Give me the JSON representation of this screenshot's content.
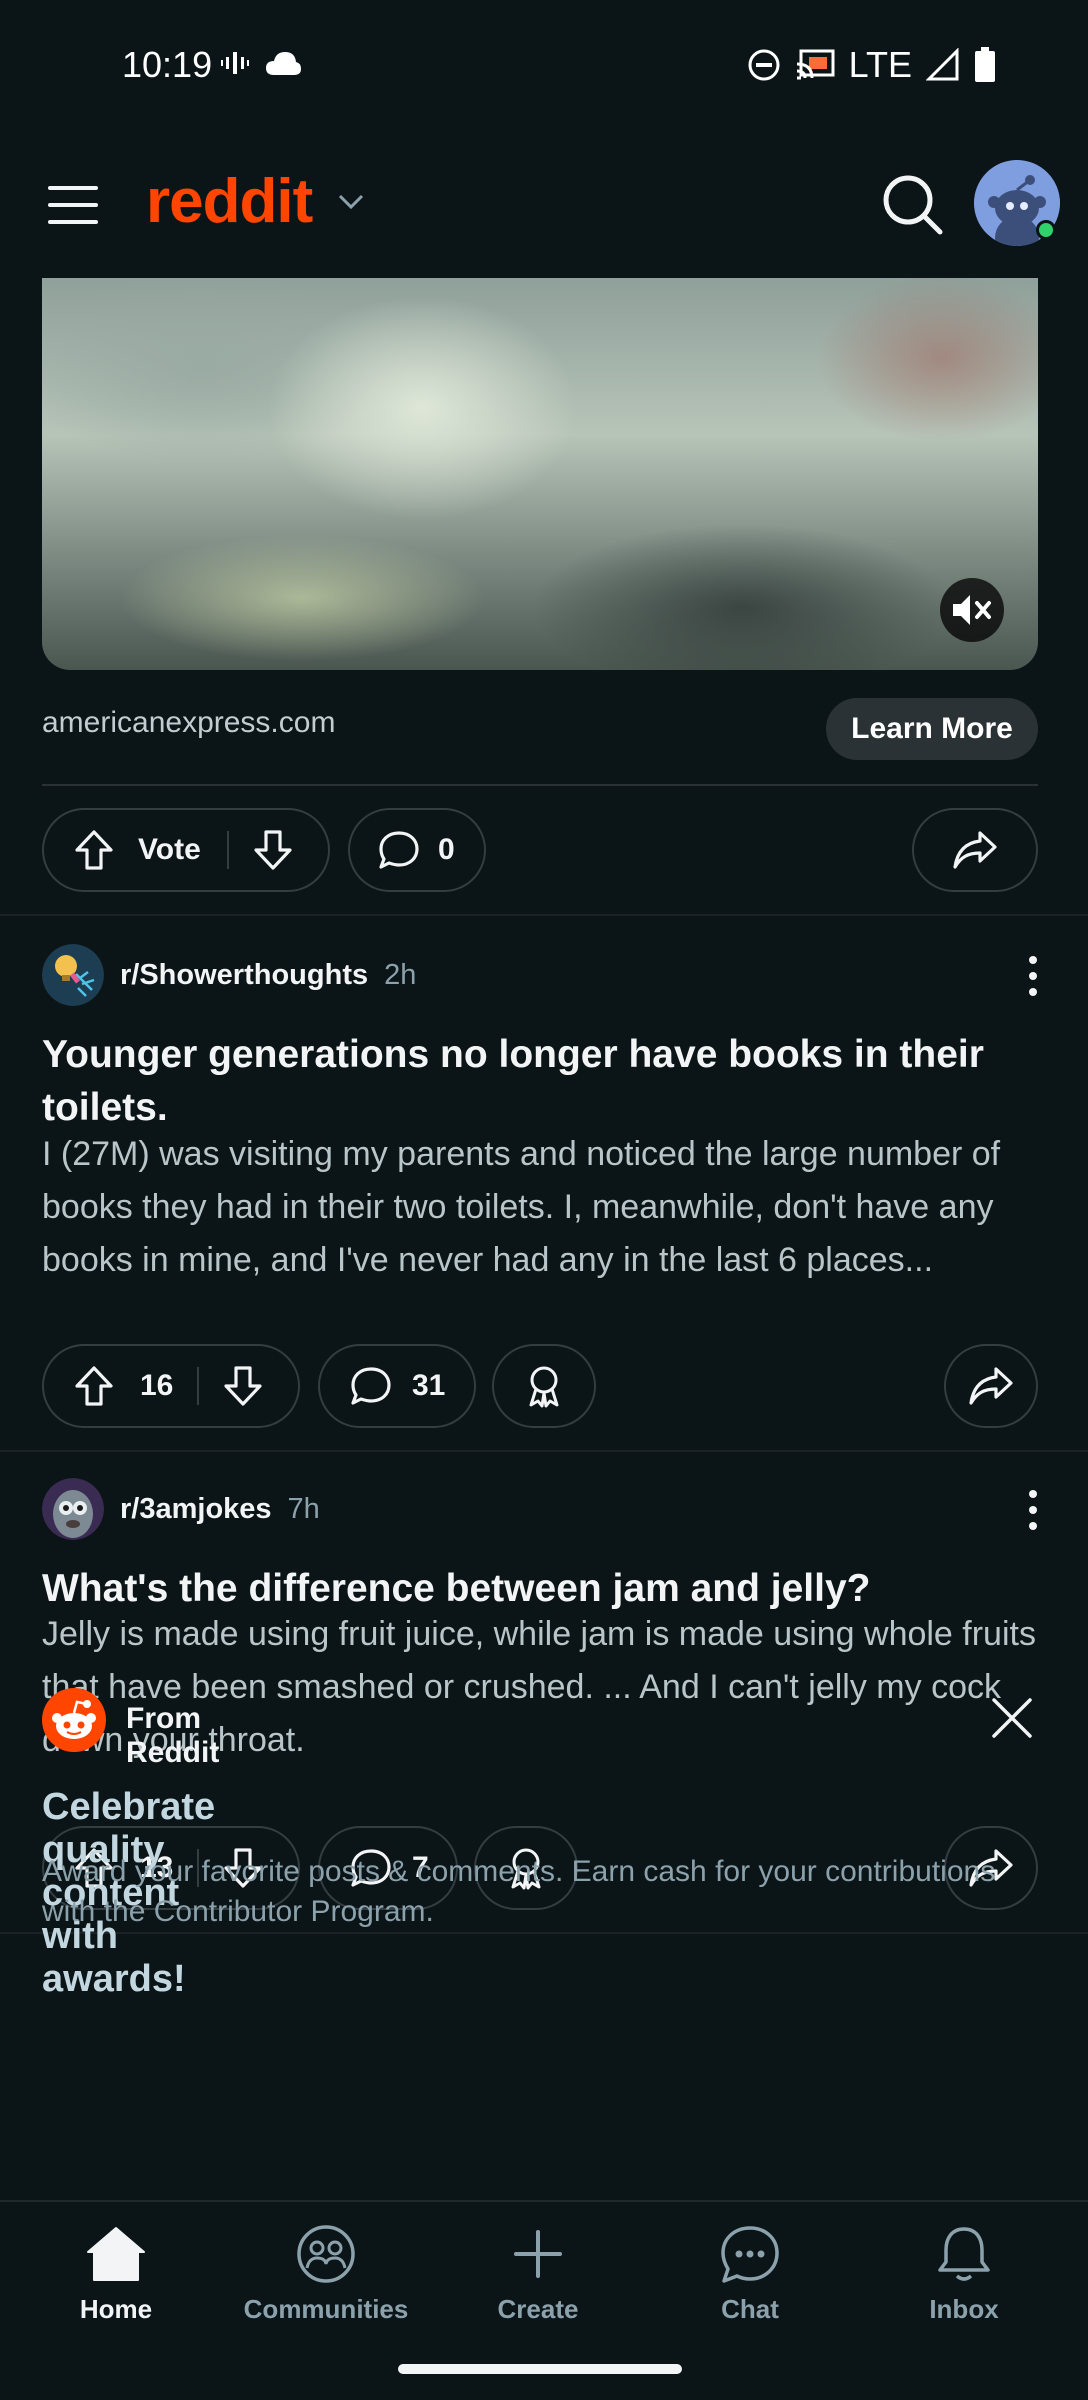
{
  "status_bar": {
    "time": "10:19",
    "network": "LTE"
  },
  "header": {
    "logo_text": "reddit",
    "icons": [
      "menu-icon",
      "chevron-down-icon",
      "search-icon",
      "avatar"
    ]
  },
  "ad": {
    "domain": "americanexpress.com",
    "cta_label": "Learn More",
    "vote_label": "Vote",
    "comment_count": "0"
  },
  "posts": [
    {
      "subreddit": "r/Showerthoughts",
      "time": "2h",
      "title": "Younger generations no longer have books in their toilets.",
      "body": "I (27M) was visiting my parents and noticed the large number of books they had in their two toilets. I, meanwhile, don't have any books in mine, and I've never had any in the last 6 places...",
      "votes": "16",
      "comments": "31"
    },
    {
      "subreddit": "r/3amjokes",
      "time": "7h",
      "title": "What's the difference between jam and jelly?",
      "body": "Jelly is made using fruit juice, while jam is made using whole fruits that have been smashed or crushed. ... And I can't jelly my cock down your throat.",
      "votes": "13",
      "comments": "7"
    }
  ],
  "promo": {
    "label": "From Reddit",
    "title": "Celebrate quality content with awards!",
    "body": "Award your favorite posts & comments. Earn cash for your contributions with the Contributor Program."
  },
  "bottom_nav": {
    "items": [
      {
        "label": "Home",
        "icon": "home-icon",
        "active": true
      },
      {
        "label": "Communities",
        "icon": "communities-icon",
        "active": false
      },
      {
        "label": "Create",
        "icon": "plus-icon",
        "active": false
      },
      {
        "label": "Chat",
        "icon": "chat-icon",
        "active": false
      },
      {
        "label": "Inbox",
        "icon": "bell-icon",
        "active": false
      }
    ]
  },
  "colors": {
    "background": "#0b1416",
    "brand": "#ff4500",
    "text": "#f2f4f5",
    "muted": "#8ba2ad"
  }
}
